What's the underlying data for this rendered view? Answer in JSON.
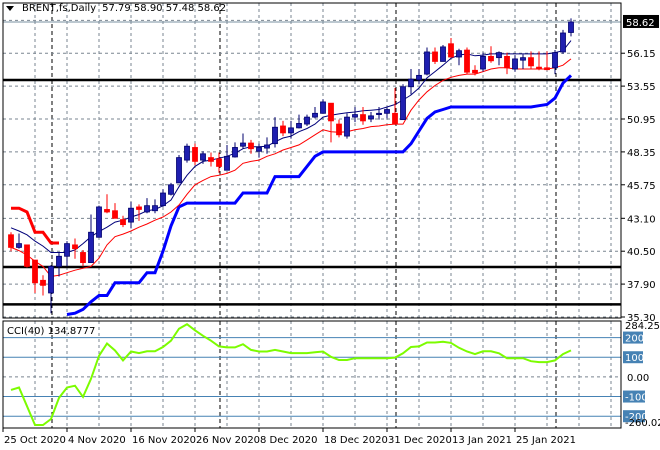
{
  "header": {
    "symbol": "BRENT,fs,Daily",
    "ohlc": "57.79 58.90 57.48 58.62"
  },
  "indicator": {
    "name": "CCI(40)",
    "value": "134.8777"
  },
  "colors": {
    "bull": "#1f1fb0",
    "bull_outline": "#00006e",
    "bear": "#ff0000",
    "ma_fast": "#00007a",
    "ma_slow": "#ff0000",
    "upper_band": "#ff0000",
    "lower_band": "#0000ff",
    "cci": "#7cfc00",
    "cci_level": "#4682b4",
    "grid": "#7a8590"
  },
  "chart_data": {
    "type": "candlestick",
    "price_axis": {
      "range": [
        35.22,
        60.12
      ],
      "ticks": [
        "56.15",
        "53.55",
        "50.95",
        "48.35",
        "45.75",
        "43.10",
        "40.50",
        "37.90",
        "35.30"
      ],
      "current": "58.62"
    },
    "date_labels": [
      "25 Oct 2020",
      "4 Nov 2020",
      "16 Nov 2020",
      "26 Nov 2020",
      "8 Dec 2020",
      "18 Dec 2020",
      "31 Dec 2020",
      "13 Jan 2021",
      "25 Jan 2021"
    ],
    "horizontal_levels": [
      54.03,
      39.25,
      36.3
    ],
    "ohlc": [
      [
        41.8,
        42.0,
        40.5,
        40.8
      ],
      [
        40.8,
        41.9,
        40.7,
        41.1
      ],
      [
        41.0,
        41.0,
        39.2,
        39.3
      ],
      [
        39.8,
        39.8,
        37.2,
        38.0
      ],
      [
        38.2,
        38.6,
        37.0,
        37.8
      ],
      [
        37.2,
        39.4,
        35.6,
        39.3
      ],
      [
        39.3,
        40.4,
        38.5,
        40.1
      ],
      [
        40.1,
        41.3,
        39.3,
        41.1
      ],
      [
        41.0,
        41.5,
        39.9,
        40.7
      ],
      [
        40.4,
        40.6,
        39.3,
        39.6
      ],
      [
        39.6,
        43.4,
        39.6,
        42.0
      ],
      [
        41.6,
        44.1,
        41.6,
        44.0
      ],
      [
        43.8,
        45.0,
        43.5,
        43.6
      ],
      [
        43.7,
        44.3,
        43.1,
        43.1
      ],
      [
        43.0,
        43.3,
        42.4,
        42.6
      ],
      [
        42.8,
        44.4,
        42.3,
        43.9
      ],
      [
        44.0,
        44.2,
        42.9,
        43.8
      ],
      [
        43.6,
        44.7,
        43.5,
        44.1
      ],
      [
        43.7,
        44.6,
        43.5,
        44.1
      ],
      [
        44.1,
        45.4,
        44.0,
        45.1
      ],
      [
        45.0,
        45.9,
        44.9,
        45.75
      ],
      [
        45.9,
        48.1,
        45.9,
        47.9
      ],
      [
        47.7,
        49.0,
        47.5,
        48.8
      ],
      [
        48.7,
        49.0,
        47.3,
        47.6
      ],
      [
        47.7,
        48.4,
        47.4,
        48.2
      ],
      [
        47.9,
        48.3,
        47.2,
        47.6
      ],
      [
        47.8,
        48.3,
        46.7,
        47.2
      ],
      [
        46.9,
        48.9,
        46.9,
        48.0
      ],
      [
        47.95,
        49.1,
        47.9,
        48.7
      ],
      [
        48.8,
        49.8,
        48.6,
        49.05
      ],
      [
        49.05,
        49.3,
        48.2,
        48.6
      ],
      [
        48.4,
        49.0,
        47.9,
        48.7
      ],
      [
        48.65,
        49.5,
        48.2,
        48.9
      ],
      [
        49.0,
        51.1,
        48.7,
        50.3
      ],
      [
        50.4,
        50.8,
        49.6,
        49.85
      ],
      [
        49.85,
        50.8,
        49.4,
        50.25
      ],
      [
        50.25,
        51.3,
        50.2,
        50.6
      ],
      [
        50.55,
        51.3,
        50.4,
        51.1
      ],
      [
        51.1,
        51.9,
        51.0,
        51.4
      ],
      [
        51.4,
        52.5,
        51.4,
        52.3
      ],
      [
        52.2,
        52.2,
        49.1,
        50.8
      ],
      [
        50.55,
        50.9,
        49.5,
        49.7
      ],
      [
        49.6,
        51.4,
        49.4,
        51.1
      ],
      [
        51.1,
        51.9,
        50.7,
        51.3
      ],
      [
        51.3,
        51.9,
        50.5,
        50.8
      ],
      [
        50.95,
        51.5,
        50.7,
        51.2
      ],
      [
        51.3,
        51.9,
        50.9,
        51.4
      ],
      [
        51.4,
        51.9,
        51.0,
        51.7
      ],
      [
        51.4,
        53.4,
        50.5,
        50.55
      ],
      [
        50.9,
        53.7,
        50.9,
        53.5
      ],
      [
        53.5,
        54.9,
        52.9,
        54.1
      ],
      [
        54.05,
        54.9,
        53.7,
        54.4
      ],
      [
        54.5,
        56.6,
        54.4,
        56.25
      ],
      [
        56.25,
        56.6,
        55.3,
        55.5
      ],
      [
        55.5,
        56.8,
        55.5,
        56.65
      ],
      [
        56.9,
        57.35,
        55.8,
        55.85
      ],
      [
        55.85,
        56.5,
        55.2,
        56.35
      ],
      [
        56.4,
        56.6,
        54.5,
        54.65
      ],
      [
        54.8,
        55.2,
        54.4,
        54.6
      ],
      [
        54.9,
        56.2,
        54.7,
        55.9
      ],
      [
        55.9,
        56.7,
        55.4,
        55.55
      ],
      [
        55.8,
        56.3,
        55.2,
        56.2
      ],
      [
        55.9,
        56.2,
        54.5,
        55.0
      ],
      [
        54.9,
        56.0,
        54.7,
        55.7
      ],
      [
        55.6,
        56.05,
        54.9,
        55.8
      ],
      [
        55.8,
        56.3,
        54.9,
        55.15
      ],
      [
        55.05,
        56.3,
        54.8,
        54.9
      ],
      [
        55.0,
        56.3,
        54.8,
        54.85
      ],
      [
        55.0,
        56.4,
        54.5,
        56.2
      ],
      [
        56.25,
        58.0,
        56.1,
        57.75
      ],
      [
        57.79,
        58.9,
        57.48,
        58.62
      ]
    ],
    "ma_fast": [
      42.35,
      42.1,
      41.8,
      41.3,
      40.9,
      40.4,
      40.4,
      40.4,
      40.6,
      41.1,
      41.65,
      42.05,
      42.4,
      42.8,
      42.95,
      43.2,
      43.4,
      43.7,
      43.8,
      44.1,
      44.55,
      45.6,
      46.5,
      47.2,
      47.6,
      47.7,
      47.85,
      48.0,
      48.25,
      48.6,
      48.75,
      48.75,
      48.8,
      49.15,
      49.45,
      49.6,
      49.95,
      50.2,
      50.55,
      51.1,
      51.25,
      51.35,
      51.45,
      51.5,
      51.6,
      51.65,
      51.7,
      51.9,
      52.1,
      52.45,
      52.85,
      53.4,
      54.2,
      54.7,
      55.2,
      55.75,
      56.0,
      56.1,
      55.95,
      56.0,
      56.1,
      56.1,
      56.1,
      56.1,
      56.1,
      56.1,
      56.1,
      56.1,
      56.2,
      56.35,
      57.15
    ],
    "ma_slow": [
      40.8,
      40.55,
      40.2,
      39.7,
      39.3,
      38.5,
      38.6,
      38.8,
      39.0,
      39.15,
      39.3,
      39.95,
      41.0,
      41.65,
      41.85,
      42.1,
      42.4,
      42.65,
      42.95,
      43.2,
      43.6,
      44.15,
      45.0,
      45.75,
      46.1,
      46.4,
      46.5,
      46.65,
      46.9,
      47.45,
      47.6,
      47.7,
      48.0,
      48.2,
      48.5,
      48.7,
      48.9,
      49.3,
      49.7,
      50.1,
      49.95,
      49.9,
      49.95,
      50.1,
      50.2,
      50.35,
      50.4,
      50.5,
      50.55,
      50.55,
      51.65,
      52.45,
      53.1,
      53.6,
      54.0,
      54.25,
      54.4,
      54.5,
      54.5,
      54.7,
      54.9,
      55.0,
      55.0,
      54.9,
      54.9,
      54.9,
      54.9,
      54.9,
      55.0,
      55.2,
      55.7
    ],
    "upper_band": [
      43.9,
      43.9,
      43.6,
      42.0,
      42.0,
      41.15,
      41.15,
      null,
      null,
      null,
      null,
      null,
      null,
      null,
      null,
      null,
      null,
      null,
      null,
      null,
      null,
      null,
      null,
      null,
      null,
      null,
      null,
      null,
      null,
      null,
      null,
      null,
      null,
      null,
      null,
      null,
      null,
      null,
      null,
      null,
      null,
      null,
      null,
      null,
      null,
      null,
      null,
      null,
      null,
      null,
      null,
      null,
      null,
      null,
      null,
      null,
      null,
      null,
      null,
      null,
      null,
      null,
      null,
      null,
      null,
      null,
      null,
      null,
      null,
      null,
      null
    ],
    "lower_band": [
      null,
      null,
      null,
      null,
      null,
      null,
      null,
      35.5,
      35.6,
      35.9,
      36.5,
      37.0,
      37.0,
      38.0,
      38.0,
      38.0,
      38.0,
      38.8,
      38.8,
      40.5,
      42.5,
      44.0,
      44.3,
      44.3,
      44.3,
      44.3,
      44.3,
      44.3,
      44.3,
      45.1,
      45.1,
      45.1,
      45.1,
      46.4,
      46.4,
      46.4,
      46.4,
      47.2,
      48.0,
      48.35,
      48.35,
      48.35,
      48.35,
      48.35,
      48.35,
      48.35,
      48.35,
      48.35,
      48.35,
      48.35,
      49.0,
      50.0,
      51.0,
      51.5,
      51.7,
      51.9,
      51.9,
      51.9,
      51.9,
      51.9,
      51.9,
      51.9,
      51.9,
      51.9,
      51.9,
      51.9,
      52.0,
      52.1,
      52.6,
      53.8,
      54.4
    ],
    "cci": {
      "range": [
        -260.028,
        284.2522
      ],
      "range_labels": [
        "284.2522",
        "-260.028"
      ],
      "levels": [
        200,
        100,
        -100,
        -200
      ],
      "level_labels": [
        "200",
        "100",
        "-100",
        "-200"
      ],
      "zero_label": "0.00",
      "values": [
        -66,
        -54,
        -149,
        -245,
        -245,
        -214,
        -107,
        -54,
        -45,
        -102,
        -10,
        107,
        170,
        134,
        84,
        129,
        121,
        130,
        130,
        152,
        184,
        245,
        268,
        237,
        209,
        184,
        155,
        150,
        150,
        166,
        137,
        129,
        129,
        137,
        129,
        121,
        121,
        121,
        125,
        129,
        102,
        86,
        86,
        95,
        95,
        95,
        95,
        95,
        98,
        120,
        152,
        155,
        175,
        175,
        179,
        173,
        148,
        129,
        116,
        130,
        130,
        120,
        95,
        95,
        95,
        80,
        75,
        75,
        84,
        116,
        134.88
      ]
    }
  }
}
